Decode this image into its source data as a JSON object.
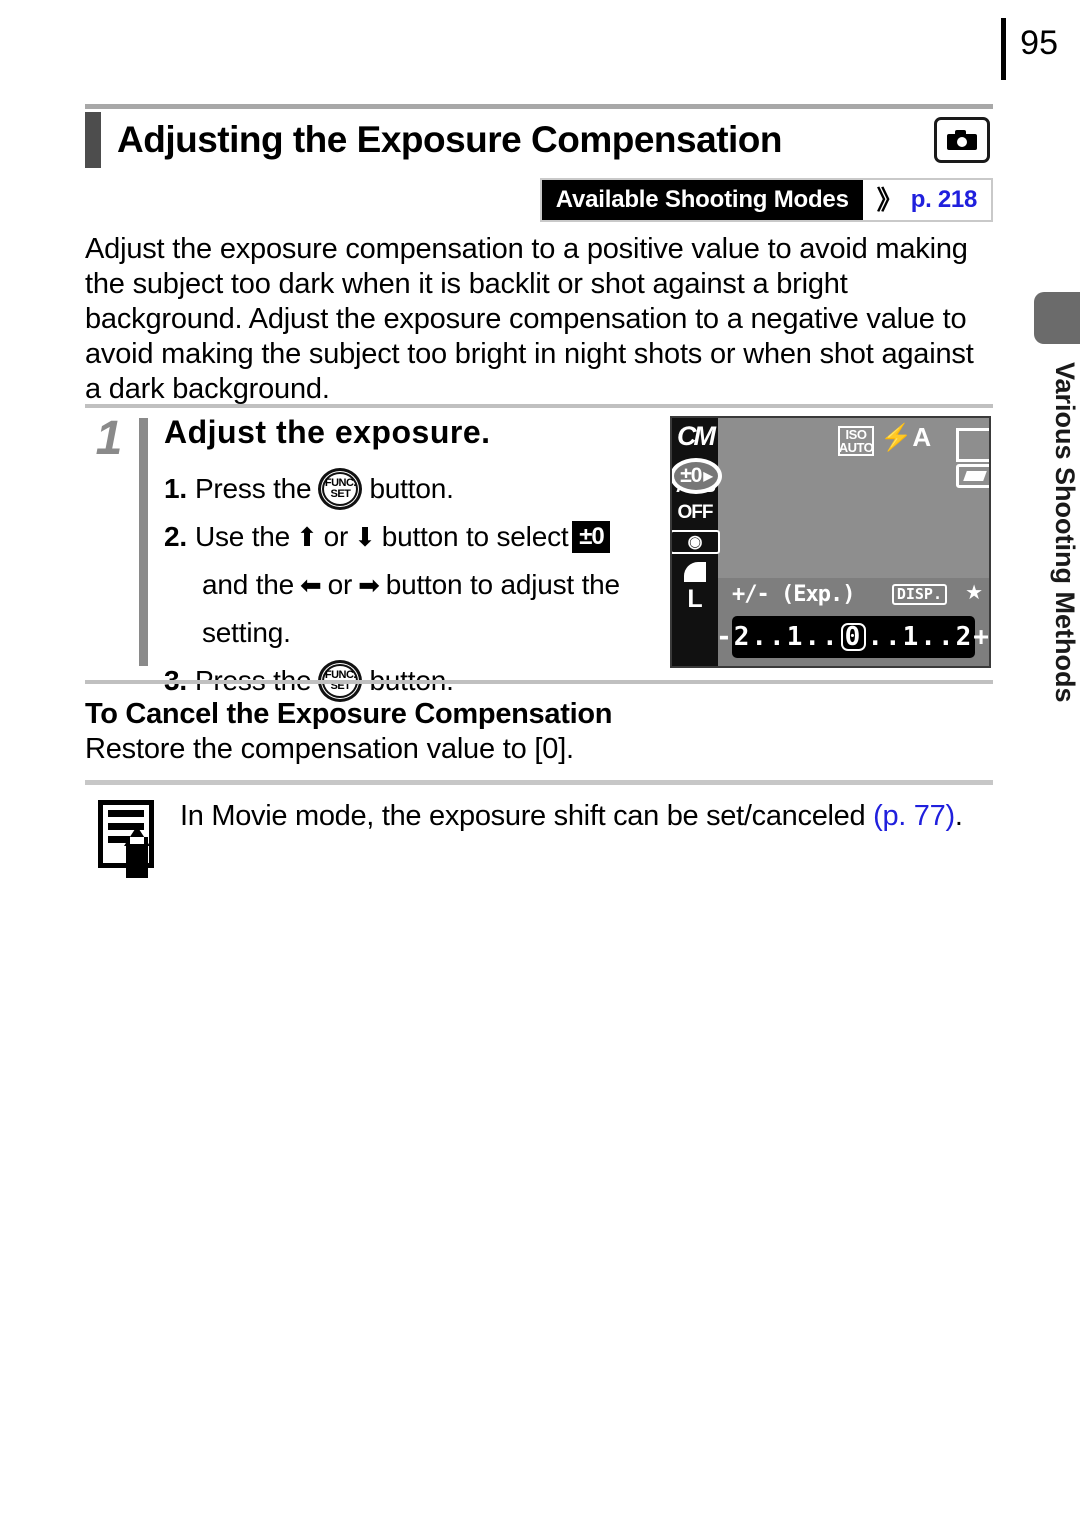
{
  "page": {
    "number": "95"
  },
  "title": {
    "heading": "Adjusting the Exposure Compensation",
    "mode_icon": "camera-icon"
  },
  "modes_badge": {
    "label": "Available Shooting Modes",
    "chevron": "》",
    "page_ref": "p. 218",
    "link_color": "#2020dd"
  },
  "intro": {
    "text": "Adjust the exposure compensation to a positive value to avoid making the subject too dark when it is backlit or shot against a bright background. Adjust the exposure compensation to a negative value to avoid making the subject too bright in night shots or when shot against a dark background."
  },
  "step": {
    "number": "1",
    "title": "Adjust the exposure.",
    "items": [
      {
        "num": "1.",
        "pre": "Press the",
        "post": "button."
      },
      {
        "num": "2.",
        "pre": "Use the",
        "mid_or": "or",
        "post": "button to select",
        "line2_pre": "and the",
        "line2_or": "or",
        "line2_post": "button to adjust the",
        "line3": "setting."
      },
      {
        "num": "3.",
        "pre": "Press the",
        "post": "button."
      }
    ],
    "icons": {
      "funcset_line1": "FUNC.",
      "funcset_line2": "SET",
      "up_arrow": "⬆",
      "down_arrow": "⬇",
      "left_arrow": "⬅",
      "right_arrow": "➡",
      "exposure_badge": "±0"
    }
  },
  "lcd": {
    "left_column": {
      "mode": "CM",
      "exposure_value": "±0",
      "exposure_arrow": "▶",
      "white_balance": "AWB",
      "flash": "OFF",
      "metering": "◉",
      "compression": "superfine-icon",
      "resolution": "L"
    },
    "top_right": {
      "iso_line1": "ISO",
      "iso_line2": "AUTO",
      "flash_mode": "⚡A",
      "af_frame": "af-frame-icon",
      "shake_warning": "camera-shake-icon",
      "battery": "battery-icon"
    },
    "bottom": {
      "label": "+/- (Exp.)",
      "disp": "DISP.",
      "star": "★",
      "scale_left": "-2..1..",
      "scale_zero": "0",
      "scale_right": "..1..2+"
    }
  },
  "cancel": {
    "heading": "To Cancel the Exposure Compensation",
    "text": "Restore the compensation value to [0]."
  },
  "note": {
    "icon": "note-pencil-icon",
    "text_before": "In Movie mode, the exposure shift can be set/canceled ",
    "link": "(p. 77)",
    "text_after": "."
  },
  "side_tab": {
    "label": "Various Shooting Methods",
    "chip_color": "#6b6b6b"
  }
}
